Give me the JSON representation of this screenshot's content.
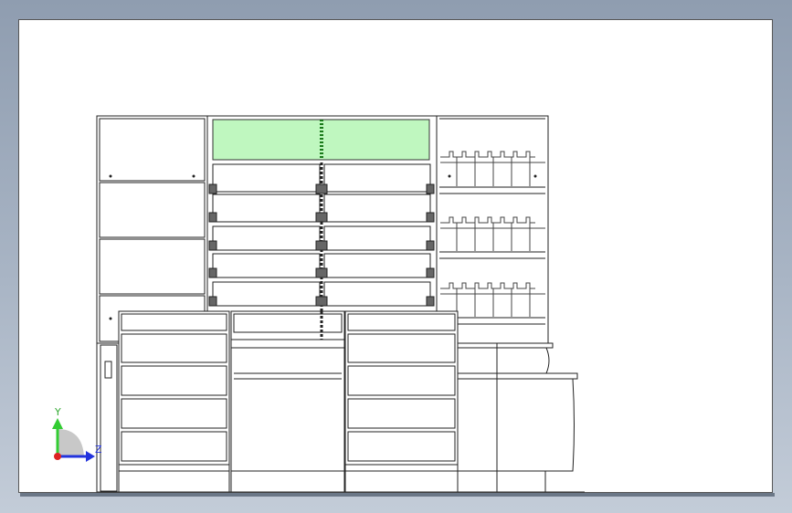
{
  "viewport": {
    "background": "#ffffff",
    "highlight_color": "#bff7bf",
    "line_color": "#222222"
  },
  "triad": {
    "y_label": "Y",
    "z_label": "Z",
    "y_color": "#33cc33",
    "z_color": "#2233dd",
    "origin_color": "#dd2222"
  }
}
